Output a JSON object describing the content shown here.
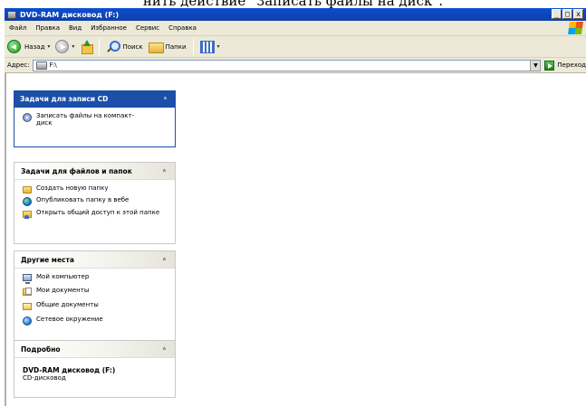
{
  "caption": "нить действие \"Записать файлы на диск\".",
  "window": {
    "title": "DVD-RAM дисковод (F:)",
    "buttons": [
      "_",
      "□",
      "x"
    ]
  },
  "menu": [
    "Файл",
    "Правка",
    "Вид",
    "Избранное",
    "Сервис",
    "Справка"
  ],
  "toolbar": {
    "back": "Назад",
    "search": "Поиск",
    "folders": "Папки"
  },
  "address": {
    "label": "Адрес:",
    "value": "F:\\",
    "go": "Переход"
  },
  "panels": {
    "cd_tasks": {
      "title": "Задачи для записи CD",
      "items": [
        {
          "label": "Записать файлы на компакт-диск",
          "icon": "burn-cd-icon"
        }
      ]
    },
    "file_tasks": {
      "title": "Задачи для файлов и папок",
      "items": [
        {
          "label": "Создать новую папку",
          "icon": "new-folder-icon"
        },
        {
          "label": "Опубликовать папку в вебе",
          "icon": "globe-icon"
        },
        {
          "label": "Открыть общий доступ к этой папке",
          "icon": "share-folder-icon"
        }
      ]
    },
    "other_places": {
      "title": "Другие места",
      "items": [
        {
          "label": "Мой компьютер",
          "icon": "my-computer-icon"
        },
        {
          "label": "Мои документы",
          "icon": "my-documents-icon"
        },
        {
          "label": "Общие документы",
          "icon": "shared-documents-icon"
        },
        {
          "label": "Сетевое окружение",
          "icon": "network-icon"
        }
      ]
    },
    "details": {
      "title": "Подробно",
      "name": "DVD-RAM дисковод (F:)",
      "type": "CD-дисковод"
    }
  },
  "chevron": "»"
}
